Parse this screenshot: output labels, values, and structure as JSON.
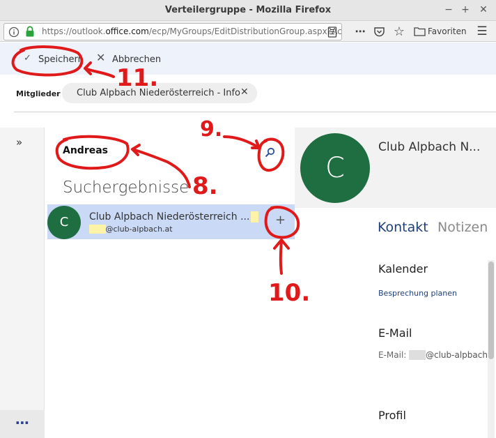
{
  "window": {
    "title": "Verteilergruppe - Mozilla Firefox"
  },
  "browser": {
    "url_prefix": "https://outlook.",
    "url_domain": "office.com",
    "url_suffix": "/ecp/MyGroups/EditDistributionGroup.aspx?Ac",
    "favorites_label": "Favoriten"
  },
  "toolbar": {
    "save_label": "Speichern",
    "cancel_label": "Abbrechen"
  },
  "members": {
    "label": "Mitglieder",
    "chip_label": "Club Alpbach Niederösterreich - Info"
  },
  "search": {
    "value": "Andreas",
    "results_title": "Suchergebnisse"
  },
  "result": {
    "avatar_letter": "C",
    "name": "Club Alpbach Niederösterreich ...",
    "email_domain": "@club-alpbach.at"
  },
  "contact": {
    "avatar_letter": "C",
    "name": "Club Alpbach N...",
    "tabs": [
      "Kontakt",
      "Notizen"
    ],
    "calendar_title": "Kalender",
    "calendar_link": "Besprechung planen",
    "email_title": "E-Mail",
    "email_label": "E-Mail:",
    "email_value": "@club-alpbach.",
    "profile_title": "Profil"
  },
  "annotations": {
    "a8": "8.",
    "a9": "9.",
    "a10": "10.",
    "a11": "11."
  },
  "colors": {
    "accent": "#1f3f7a",
    "avatar": "#1f6e42",
    "annotation": "#e01a1a",
    "selection": "#cad9f5"
  }
}
